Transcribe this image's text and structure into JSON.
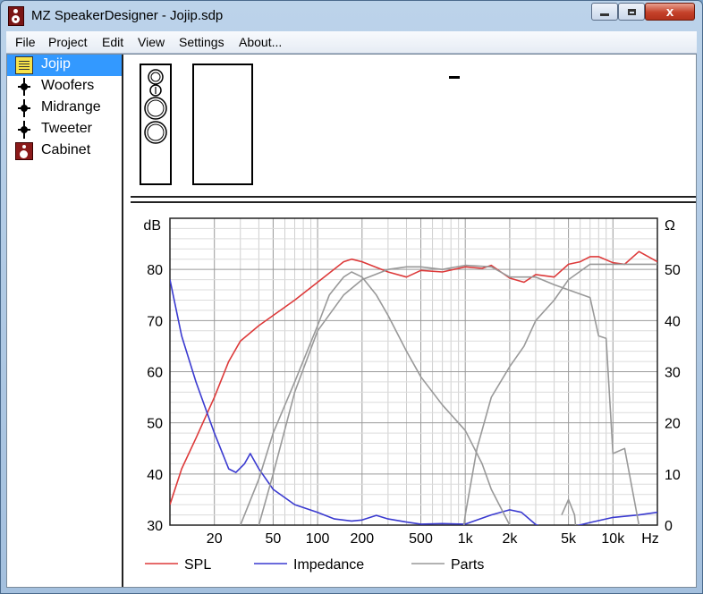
{
  "window": {
    "title": "MZ SpeakerDesigner - Jojip.sdp",
    "controls": {
      "minimize": "minimize",
      "maximize": "maximize",
      "close": "x"
    }
  },
  "menu": [
    "File",
    "Project",
    "Edit",
    "View",
    "Settings",
    "About..."
  ],
  "tree": {
    "items": [
      {
        "label": "Jojip",
        "icon": "document-icon",
        "selected": true
      },
      {
        "label": "Woofers",
        "icon": "driver-node-icon"
      },
      {
        "label": "Midrange",
        "icon": "driver-node-icon"
      },
      {
        "label": "Tweeter",
        "icon": "driver-node-icon"
      },
      {
        "label": "Cabinet",
        "icon": "cabinet-icon"
      }
    ]
  },
  "preview": {
    "dash": "-"
  },
  "chart_data": {
    "type": "line",
    "x_scale": "log",
    "xlim": [
      10,
      20000
    ],
    "ylim_left": [
      30,
      90
    ],
    "ylim_right": [
      0,
      60
    ],
    "ylabel_left": "dB",
    "ylabel_right": "Ω",
    "x_unit": "Hz",
    "x_ticks": [
      {
        "v": 20,
        "l": "20"
      },
      {
        "v": 50,
        "l": "50"
      },
      {
        "v": 100,
        "l": "100"
      },
      {
        "v": 200,
        "l": "200"
      },
      {
        "v": 500,
        "l": "500"
      },
      {
        "v": 1000,
        "l": "1k"
      },
      {
        "v": 2000,
        "l": "2k"
      },
      {
        "v": 5000,
        "l": "5k"
      },
      {
        "v": 10000,
        "l": "10k"
      }
    ],
    "y_ticks_left": [
      30,
      40,
      50,
      60,
      70,
      80
    ],
    "y_ticks_right": [
      0,
      10,
      20,
      30,
      40,
      50
    ],
    "grid": true,
    "legend_position": "bottom",
    "series": [
      {
        "name": "SPL",
        "axis": "left",
        "color": "#dd3a3a",
        "x": [
          10,
          12,
          15,
          20,
          25,
          30,
          40,
          50,
          70,
          100,
          150,
          170,
          200,
          300,
          400,
          500,
          700,
          1000,
          1300,
          1500,
          2000,
          2500,
          3000,
          4000,
          5000,
          6000,
          7000,
          8000,
          10000,
          12000,
          15000,
          20000
        ],
        "y": [
          34,
          41,
          47,
          55,
          62,
          66,
          69,
          71,
          74,
          77.5,
          81.5,
          82,
          81.5,
          79.5,
          78.5,
          79.8,
          79.5,
          80.5,
          80.2,
          80.8,
          78.3,
          77.5,
          79,
          78.5,
          81,
          81.5,
          82.5,
          82.5,
          81.3,
          81,
          83.5,
          81.5
        ]
      },
      {
        "name": "Impedance",
        "axis": "right",
        "color": "#3a3ad0",
        "x": [
          10,
          12,
          15,
          20,
          25,
          28,
          32,
          35,
          40,
          50,
          70,
          100,
          130,
          170,
          200,
          250,
          300,
          400,
          500,
          700,
          1000,
          1500,
          2000,
          2400,
          3000,
          4000,
          5000,
          7000,
          10000,
          15000,
          20000
        ],
        "y": [
          48,
          37,
          28,
          18,
          11,
          10.3,
          12,
          14,
          11,
          7,
          4,
          2.5,
          1.2,
          0.8,
          1,
          1.9,
          1.2,
          0.6,
          0.2,
          0.3,
          0.2,
          2,
          3,
          2.5,
          0.1,
          -1.2,
          -0.5,
          0.5,
          1.5,
          2,
          2.5
        ]
      },
      {
        "name": "Parts",
        "axis": "left",
        "color": "#999999",
        "x": [
          30,
          40,
          50,
          70,
          100,
          120,
          150,
          170,
          200,
          250,
          300,
          400,
          500,
          700,
          1000,
          1300,
          1500,
          2000,
          2500
        ],
        "y": [
          30,
          39,
          48,
          58,
          69,
          75,
          78.5,
          79.5,
          78.5,
          75,
          71,
          64,
          59,
          53.5,
          48.5,
          42,
          37,
          30,
          24
        ]
      },
      {
        "name": "Parts",
        "axis": "left",
        "color": "#999999",
        "x": [
          40,
          50,
          70,
          100,
          150,
          200,
          300,
          400,
          500,
          700,
          1000,
          1500,
          2000,
          3000,
          4000,
          5000,
          7000,
          8000,
          9000,
          10000,
          12000,
          15000,
          20000
        ],
        "y": [
          30,
          40,
          56,
          68,
          75,
          78,
          80,
          80.5,
          80.5,
          80,
          80.8,
          80.5,
          78.5,
          78.5,
          77,
          76,
          74.5,
          67,
          66.5,
          44,
          45,
          30,
          27
        ]
      },
      {
        "name": "Parts",
        "axis": "left",
        "color": "#999999",
        "x": [
          900,
          1000,
          1200,
          1500,
          2000,
          2500,
          3000,
          4000,
          5000,
          7000,
          10000,
          15000,
          20000
        ],
        "y": [
          22,
          32,
          45,
          55,
          61,
          65,
          70,
          74,
          78,
          81,
          81,
          81,
          81
        ]
      },
      {
        "name": "Parts",
        "axis": "left",
        "color": "#999999",
        "x": [
          4500,
          5000,
          5500,
          6000
        ],
        "y": [
          32,
          35,
          32,
          20
        ]
      }
    ]
  }
}
